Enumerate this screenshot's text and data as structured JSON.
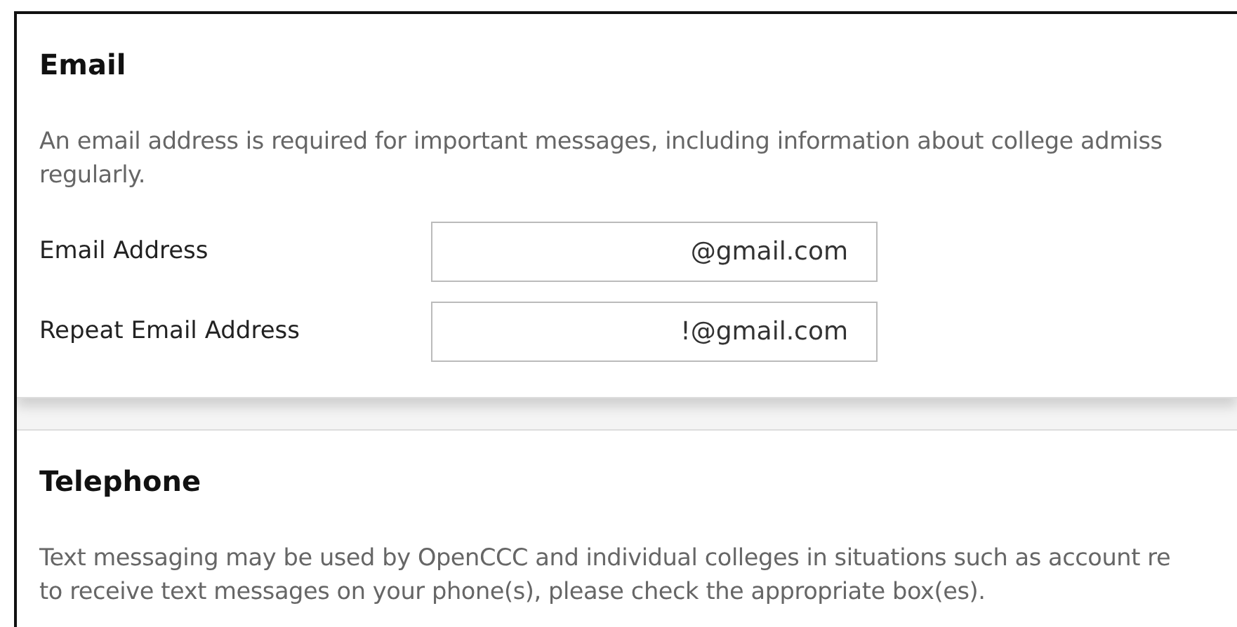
{
  "sections": [
    {
      "title": "Email",
      "description_lines": [
        "An email address is required for important messages, including information about college admiss",
        "regularly."
      ],
      "fields": [
        {
          "label": "Email Address",
          "value": "@gmail.com"
        },
        {
          "label": "Repeat Email Address",
          "value": "!@gmail.com"
        }
      ]
    },
    {
      "title": "Telephone",
      "description_lines": [
        "Text messaging may be used by OpenCCC and individual colleges in situations such as account re",
        "to receive text messages on your phone(s), please check the appropriate box(es)."
      ]
    }
  ]
}
